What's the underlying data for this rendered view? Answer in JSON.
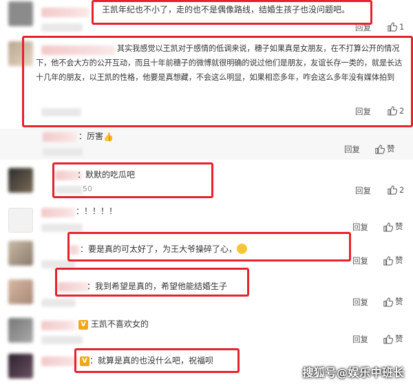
{
  "reply_label": "回复",
  "like_zan": "赞",
  "comments": [
    {
      "text": "王凯年纪也不小了，走的也不是偶像路线，结婚生孩子也没问题吧。",
      "likes": "1"
    },
    {
      "text": "其实我感觉以王凯对于感情的低调来说，穗子如果真是女朋友，在不打算公开的情况下，他不会大方的公开互动，而且十年前穗子的微博就很明确的说过他们是朋友，友谊长存一类的，就是长达十几年的朋友，以王凯的性格，他要是真想藏，不会这么明显，如果相恋多年，咋会这么多年没有媒体拍到",
      "likes": "2"
    },
    {
      "text": "：厉害",
      "likes": "赞"
    },
    {
      "text": "：默默的吃瓜吧",
      "time_tail": "50",
      "likes": "2"
    },
    {
      "text": "：！！！！",
      "likes": "赞"
    },
    {
      "text": "：要是真的可太好了，为王大爷操碎了心，",
      "likes": "赞"
    },
    {
      "text": "：我到希望是真的，希望他能结婚生子",
      "likes": "赞"
    },
    {
      "text": "王凯不喜欢女的",
      "likes": "赞"
    },
    {
      "text": "就算是真的也没什么吧，祝福呗",
      "likes": "赞"
    }
  ],
  "watermark": "搜狐号@娱乐中班长",
  "accent": "#e8202c"
}
